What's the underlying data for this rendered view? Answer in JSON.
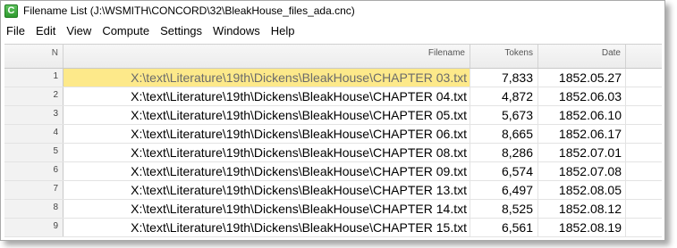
{
  "window": {
    "title": "Filename List (J:\\WSMITH\\CONCORD\\32\\BleakHouse_files_ada.cnc)",
    "app_icon": "C"
  },
  "menu": [
    "File",
    "Edit",
    "View",
    "Compute",
    "Settings",
    "Windows",
    "Help"
  ],
  "table": {
    "headers": {
      "n": "N",
      "filename": "Filename",
      "tokens": "Tokens",
      "date": "Date"
    },
    "rows": [
      {
        "n": "1",
        "filename": "X:\\text\\Literature\\19th\\Dickens\\BleakHouse\\CHAPTER 03.txt",
        "tokens": "7,833",
        "date": "1852.05.27",
        "selected": true
      },
      {
        "n": "2",
        "filename": "X:\\text\\Literature\\19th\\Dickens\\BleakHouse\\CHAPTER 04.txt",
        "tokens": "4,872",
        "date": "1852.06.03"
      },
      {
        "n": "3",
        "filename": "X:\\text\\Literature\\19th\\Dickens\\BleakHouse\\CHAPTER 05.txt",
        "tokens": "5,673",
        "date": "1852.06.10"
      },
      {
        "n": "4",
        "filename": "X:\\text\\Literature\\19th\\Dickens\\BleakHouse\\CHAPTER 06.txt",
        "tokens": "8,665",
        "date": "1852.06.17"
      },
      {
        "n": "5",
        "filename": "X:\\text\\Literature\\19th\\Dickens\\BleakHouse\\CHAPTER 08.txt",
        "tokens": "8,286",
        "date": "1852.07.01"
      },
      {
        "n": "6",
        "filename": "X:\\text\\Literature\\19th\\Dickens\\BleakHouse\\CHAPTER 09.txt",
        "tokens": "6,574",
        "date": "1852.07.08"
      },
      {
        "n": "7",
        "filename": "X:\\text\\Literature\\19th\\Dickens\\BleakHouse\\CHAPTER 13.txt",
        "tokens": "6,497",
        "date": "1852.08.05"
      },
      {
        "n": "8",
        "filename": "X:\\text\\Literature\\19th\\Dickens\\BleakHouse\\CHAPTER 14.txt",
        "tokens": "8,525",
        "date": "1852.08.12"
      },
      {
        "n": "9",
        "filename": "X:\\text\\Literature\\19th\\Dickens\\BleakHouse\\CHAPTER 15.txt",
        "tokens": "6,561",
        "date": "1852.08.19"
      }
    ]
  },
  "colors": {
    "selection": "#fde98a",
    "app_icon": "#2e9a2e"
  }
}
